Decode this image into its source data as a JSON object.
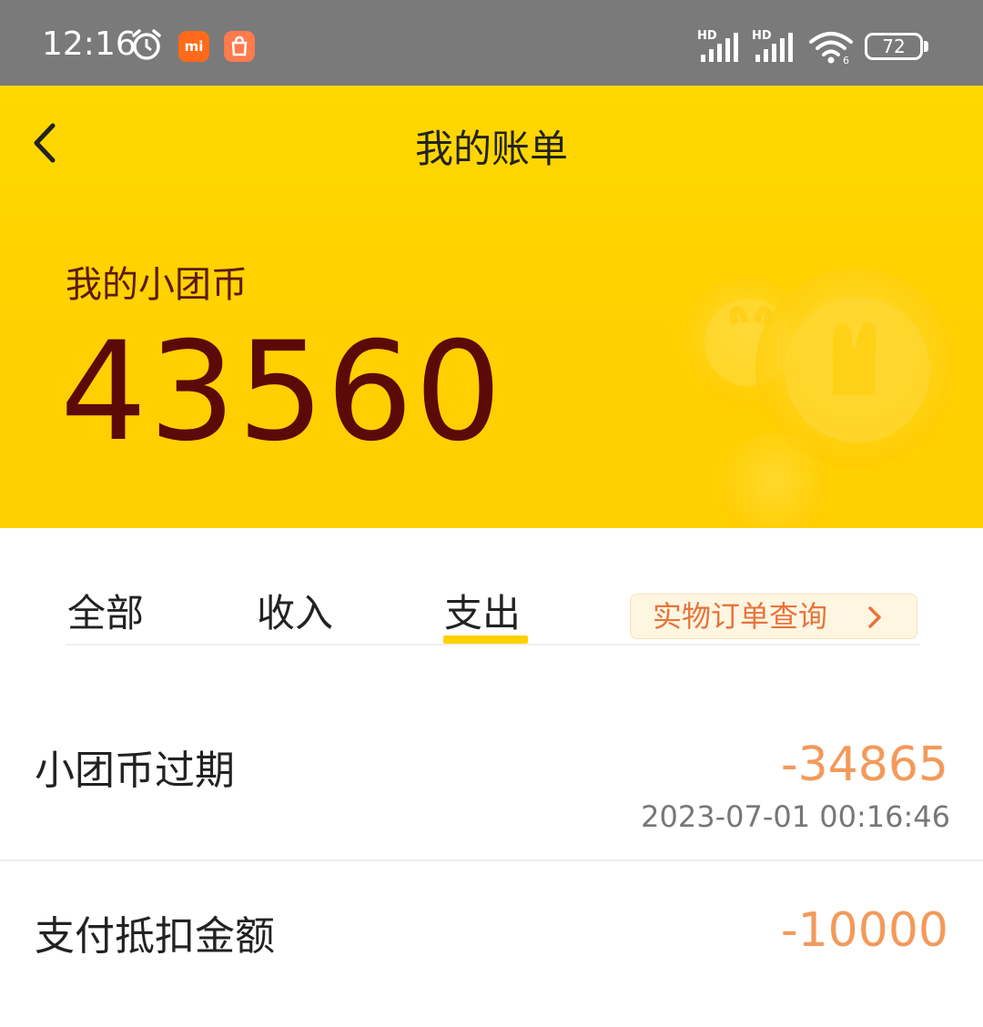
{
  "status_bar": {
    "time": "12:16",
    "app1_label": "mi",
    "battery": "72"
  },
  "header": {
    "title": "我的账单"
  },
  "hero": {
    "label": "我的小团币",
    "value": "43560"
  },
  "tabs": [
    {
      "label": "全部",
      "selected": false
    },
    {
      "label": "收入",
      "selected": false
    },
    {
      "label": "支出",
      "selected": true
    }
  ],
  "order_link": {
    "label": "实物订单查询"
  },
  "transactions": [
    {
      "title": "小团币过期",
      "amount": "-34865",
      "time": "2023-07-01 00:16:46"
    },
    {
      "title": "支付抵扣金额",
      "amount": "-10000",
      "time": ""
    }
  ],
  "colors": {
    "hero_yellow": "#ffd800",
    "coin_value": "#5c0a08",
    "amount_orange": "#f39a5a",
    "tab_indicator": "#ffd100",
    "order_link_text": "#e8743b"
  }
}
